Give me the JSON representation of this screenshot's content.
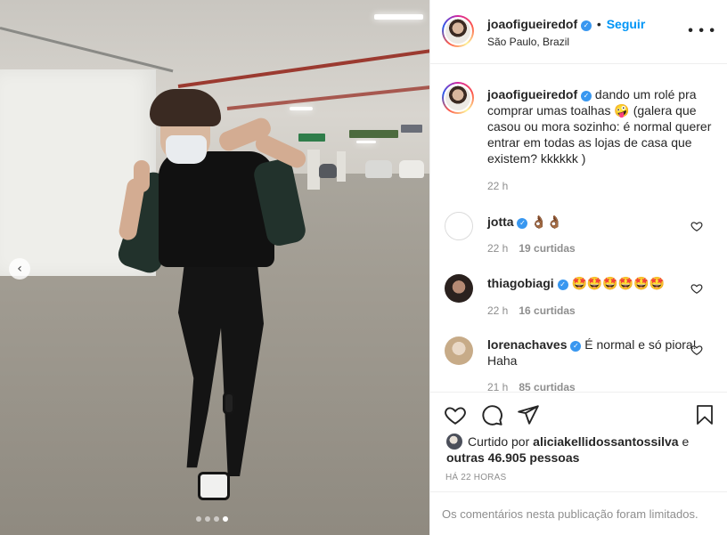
{
  "post": {
    "username": "joaofigueiredof",
    "verified_glyph": "✓",
    "separator": "•",
    "follow_label": "Seguir",
    "location": "São Paulo, Brazil",
    "more_icon": "more-options-icon",
    "caption": "dando um rolé pra comprar umas toalhas 🤪 (galera que casou ou mora sozinho: é normal querer entrar em todas as lojas de casa que existem? kkkkkk )",
    "caption_time": "22 h",
    "carousel": {
      "prev_glyph": "‹",
      "slide_count": 4,
      "active_slide": 4
    }
  },
  "comments": [
    {
      "username": "jotta",
      "text": "👌🏾👌🏾",
      "time": "22 h",
      "likes": "19 curtidas"
    },
    {
      "username": "thiagobiagi",
      "text": "🤩🤩🤩🤩🤩🤩",
      "time": "22 h",
      "likes": "16 curtidas"
    },
    {
      "username": "lorenachaves",
      "text": "É normal e só piora! Haha",
      "time": "21 h",
      "likes": "85 curtidas"
    }
  ],
  "footer": {
    "liked_prefix": "Curtido por",
    "liked_user": "aliciakellidossantossilva",
    "liked_mid": "e",
    "liked_others": "outras 46.905 pessoas",
    "posted_ago": "HÁ 22 HORAS",
    "comments_limited": "Os comentários nesta publicação foram limitados."
  },
  "colors": {
    "link_blue": "#0095f6",
    "verified_blue": "#3897f0",
    "muted": "#8e8e8e",
    "text": "#262626"
  }
}
